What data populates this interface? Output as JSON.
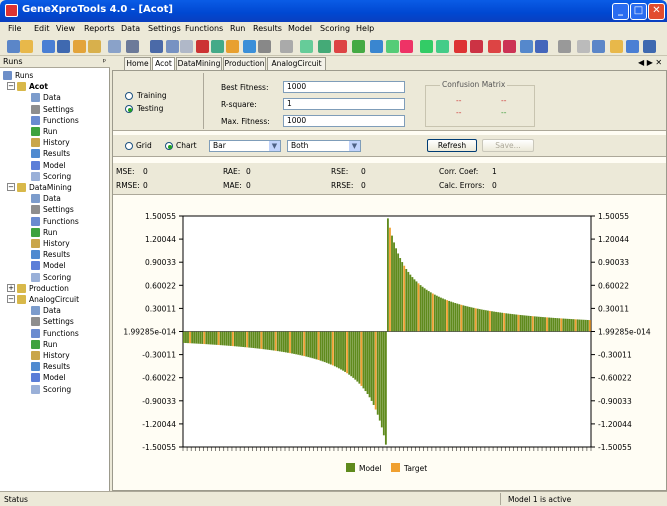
{
  "window": {
    "title": "GeneXproTools 4.0 - [Acot]"
  },
  "menu": [
    "File",
    "Edit",
    "View",
    "Reports",
    "Data",
    "Settings",
    "Functions",
    "Run",
    "Results",
    "Model",
    "Scoring",
    "Help"
  ],
  "left_panel": {
    "header": "Runs",
    "root": "Runs",
    "groups": [
      {
        "name": "Acot",
        "items": [
          "Data",
          "Settings",
          "Functions",
          "Run",
          "History",
          "Results",
          "Model",
          "Scoring"
        ]
      },
      {
        "name": "DataMining",
        "items": [
          "Data",
          "Settings",
          "Functions",
          "Run",
          "History",
          "Results",
          "Model",
          "Scoring"
        ]
      },
      {
        "name": "Production",
        "items": []
      },
      {
        "name": "AnalogCircuit",
        "items": [
          "Data",
          "Settings",
          "Functions",
          "Run",
          "History",
          "Results",
          "Model",
          "Scoring"
        ]
      }
    ]
  },
  "tabs": [
    "Home",
    "Acot",
    "DataMining",
    "Production",
    "AnalogCircuit"
  ],
  "params": {
    "training": "Training",
    "testing": "Testing",
    "best_fitness_label": "Best Fitness:",
    "best_fitness": "1000",
    "rsquare_label": "R-square:",
    "rsquare": "1",
    "max_fitness_label": "Max. Fitness:",
    "max_fitness": "1000",
    "confusion_title": "Confusion Matrix",
    "confusion_cells": [
      "--",
      "--",
      "--",
      "--"
    ]
  },
  "view": {
    "grid": "Grid",
    "chart": "Chart",
    "type": "Bar",
    "series": "Both",
    "refresh": "Refresh",
    "save": "Save..."
  },
  "stats": [
    {
      "label": "MSE:",
      "value": "0"
    },
    {
      "label": "RAE:",
      "value": "0"
    },
    {
      "label": "RSE:",
      "value": "0"
    },
    {
      "label": "Corr. Coef:",
      "value": "1"
    },
    {
      "label": "RMSE:",
      "value": "0"
    },
    {
      "label": "MAE:",
      "value": "0"
    },
    {
      "label": "RRSE:",
      "value": "0"
    },
    {
      "label": "Calc. Errors:",
      "value": "0"
    }
  ],
  "colors": {
    "model": "#5f8a1c",
    "target": "#f0a030"
  },
  "chart_data": {
    "type": "bar",
    "y_ticks": [
      "1.50055",
      "1.20044",
      "0.90033",
      "0.60022",
      "0.30011",
      "1.99285e-014",
      "-0.30011",
      "-0.60022",
      "-0.90033",
      "-1.20044",
      "-1.50055"
    ],
    "ylim": [
      -1.50055,
      1.50055
    ],
    "series": [
      {
        "name": "Model"
      },
      {
        "name": "Target"
      }
    ],
    "legend": "bottom",
    "n_points": 200
  },
  "status": {
    "left": "Status",
    "right": "Model 1 is active"
  }
}
